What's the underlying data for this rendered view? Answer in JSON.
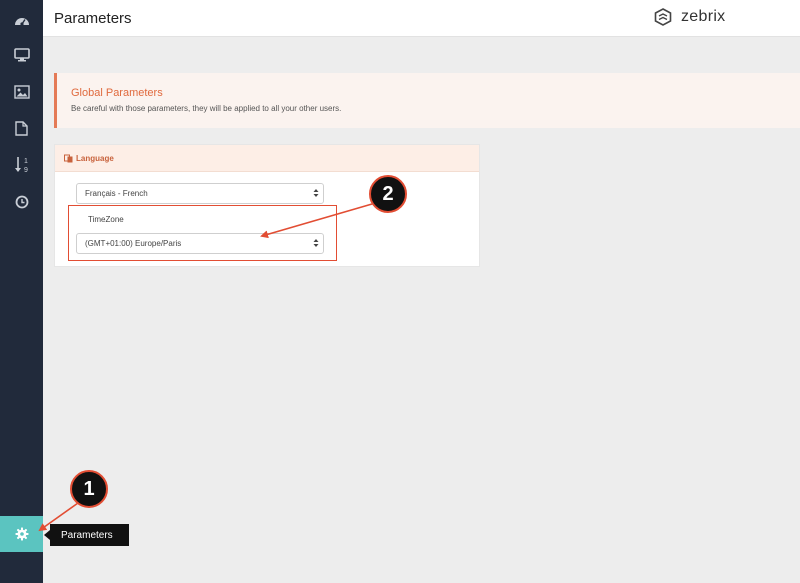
{
  "header": {
    "title": "Parameters",
    "brand": "zebrix"
  },
  "sidebar": {
    "items": [
      {
        "name": "dashboard",
        "icon": "dashboard-icon"
      },
      {
        "name": "screens",
        "icon": "monitor-icon"
      },
      {
        "name": "media",
        "icon": "image-icon"
      },
      {
        "name": "documents",
        "icon": "file-icon"
      },
      {
        "name": "sort",
        "icon": "sort-numeric-icon",
        "text_top": "1",
        "text_bottom": "9"
      },
      {
        "name": "history",
        "icon": "clock-icon"
      }
    ],
    "settings": {
      "icon": "gear-icon",
      "tooltip": "Parameters"
    }
  },
  "alert": {
    "title": "Global Parameters",
    "text": "Be careful with those parameters, they will be applied to all your other users."
  },
  "panel": {
    "title": "Language",
    "language_select": {
      "value": "Français - French"
    },
    "timezone_label": "TimeZone",
    "timezone_select": {
      "value": "(GMT+01:00) Europe/Paris"
    }
  },
  "annotations": {
    "badge_1": "1",
    "badge_2": "2"
  },
  "colors": {
    "sidebar": "#212a3b",
    "active": "#5bc4c0",
    "accent": "#e06a3e",
    "annotation": "#e24d33"
  }
}
